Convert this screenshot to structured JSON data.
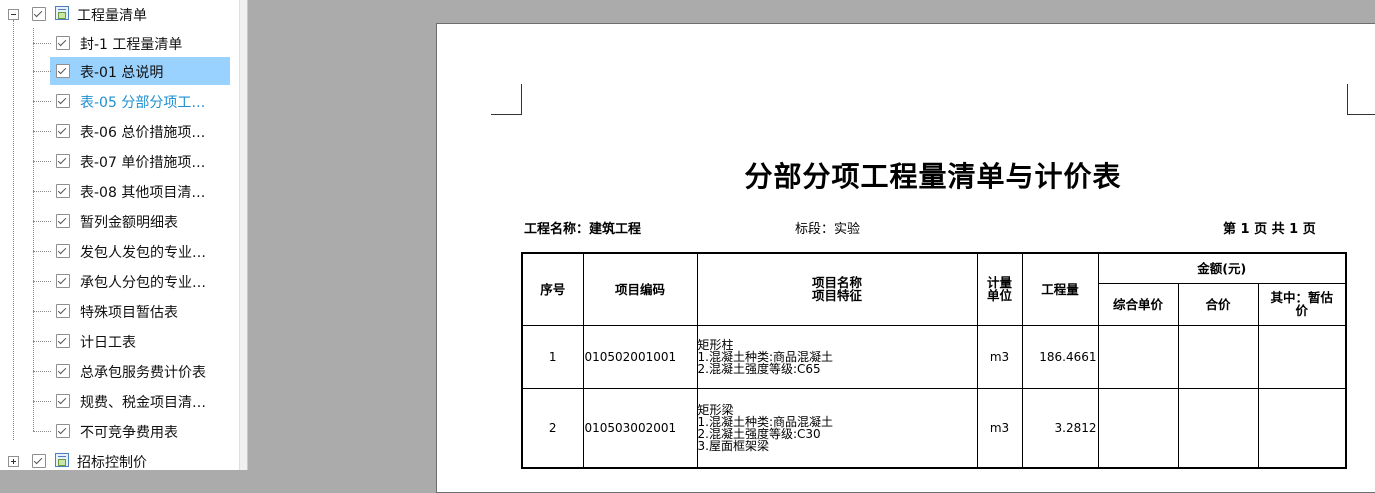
{
  "tree": {
    "items": [
      {
        "label": "工程量清单",
        "level": 0,
        "expander": "minus",
        "checked": true,
        "folder": true,
        "selected": false,
        "active": false
      },
      {
        "label": "封-1 工程量清单",
        "level": 1,
        "checked": true,
        "selected": false,
        "active": false
      },
      {
        "label": "表-01 总说明",
        "level": 1,
        "checked": true,
        "selected": true,
        "active": false
      },
      {
        "label": "表-05 分部分项工…",
        "level": 1,
        "checked": true,
        "selected": false,
        "active": true
      },
      {
        "label": "表-06 总价措施项…",
        "level": 1,
        "checked": true,
        "selected": false,
        "active": false
      },
      {
        "label": "表-07 单价措施项…",
        "level": 1,
        "checked": true,
        "selected": false,
        "active": false
      },
      {
        "label": "表-08 其他项目清…",
        "level": 1,
        "checked": true,
        "selected": false,
        "active": false
      },
      {
        "label": "暂列金额明细表",
        "level": 1,
        "checked": true,
        "selected": false,
        "active": false
      },
      {
        "label": "发包人发包的专业…",
        "level": 1,
        "checked": true,
        "selected": false,
        "active": false
      },
      {
        "label": "承包人分包的专业…",
        "level": 1,
        "checked": true,
        "selected": false,
        "active": false
      },
      {
        "label": "特殊项目暂估表",
        "level": 1,
        "checked": true,
        "selected": false,
        "active": false
      },
      {
        "label": "计日工表",
        "level": 1,
        "checked": true,
        "selected": false,
        "active": false
      },
      {
        "label": "总承包服务费计价表",
        "level": 1,
        "checked": true,
        "selected": false,
        "active": false
      },
      {
        "label": "规费、税金项目清…",
        "level": 1,
        "checked": true,
        "selected": false,
        "active": false
      },
      {
        "label": "不可竞争费用表",
        "level": 1,
        "checked": true,
        "selected": false,
        "active": false
      },
      {
        "label": "招标控制价",
        "level": 0,
        "expander": "plus",
        "checked": true,
        "folder": true,
        "selected": false,
        "active": false
      }
    ]
  },
  "document": {
    "title": "分部分项工程量清单与计价表",
    "project_name": "工程名称：建筑工程",
    "section": "标段：实验",
    "page_info": "第 1 页  共 1 页",
    "headers": {
      "seq": "序号",
      "code": "项目编码",
      "name_line1": "项目名称",
      "name_line2": "项目特征",
      "unit_line1": "计量",
      "unit_line2": "单位",
      "quantity": "工程量",
      "amount_group": "金额(元)",
      "unit_price": "综合单价",
      "total": "合价",
      "provisional_line1": "其中：暂估",
      "provisional_line2": "价"
    },
    "rows": [
      {
        "seq": "1",
        "code": "010502001001",
        "desc": [
          "矩形柱",
          "1.混凝土种类:商品混凝土",
          "2.混凝土强度等级:C65"
        ],
        "unit": "m3",
        "quantity": "186.4661"
      },
      {
        "seq": "2",
        "code": "010503002001",
        "desc": [
          "矩形梁",
          "1.混凝土种类:商品混凝土",
          "2.混凝土强度等级:C30",
          "3.屋面框架梁"
        ],
        "unit": "m3",
        "quantity": "3.2812"
      }
    ]
  },
  "colors": {
    "selection": "#99d1ff",
    "active_text": "#1e90d0",
    "workspace_bg": "#ababab"
  }
}
